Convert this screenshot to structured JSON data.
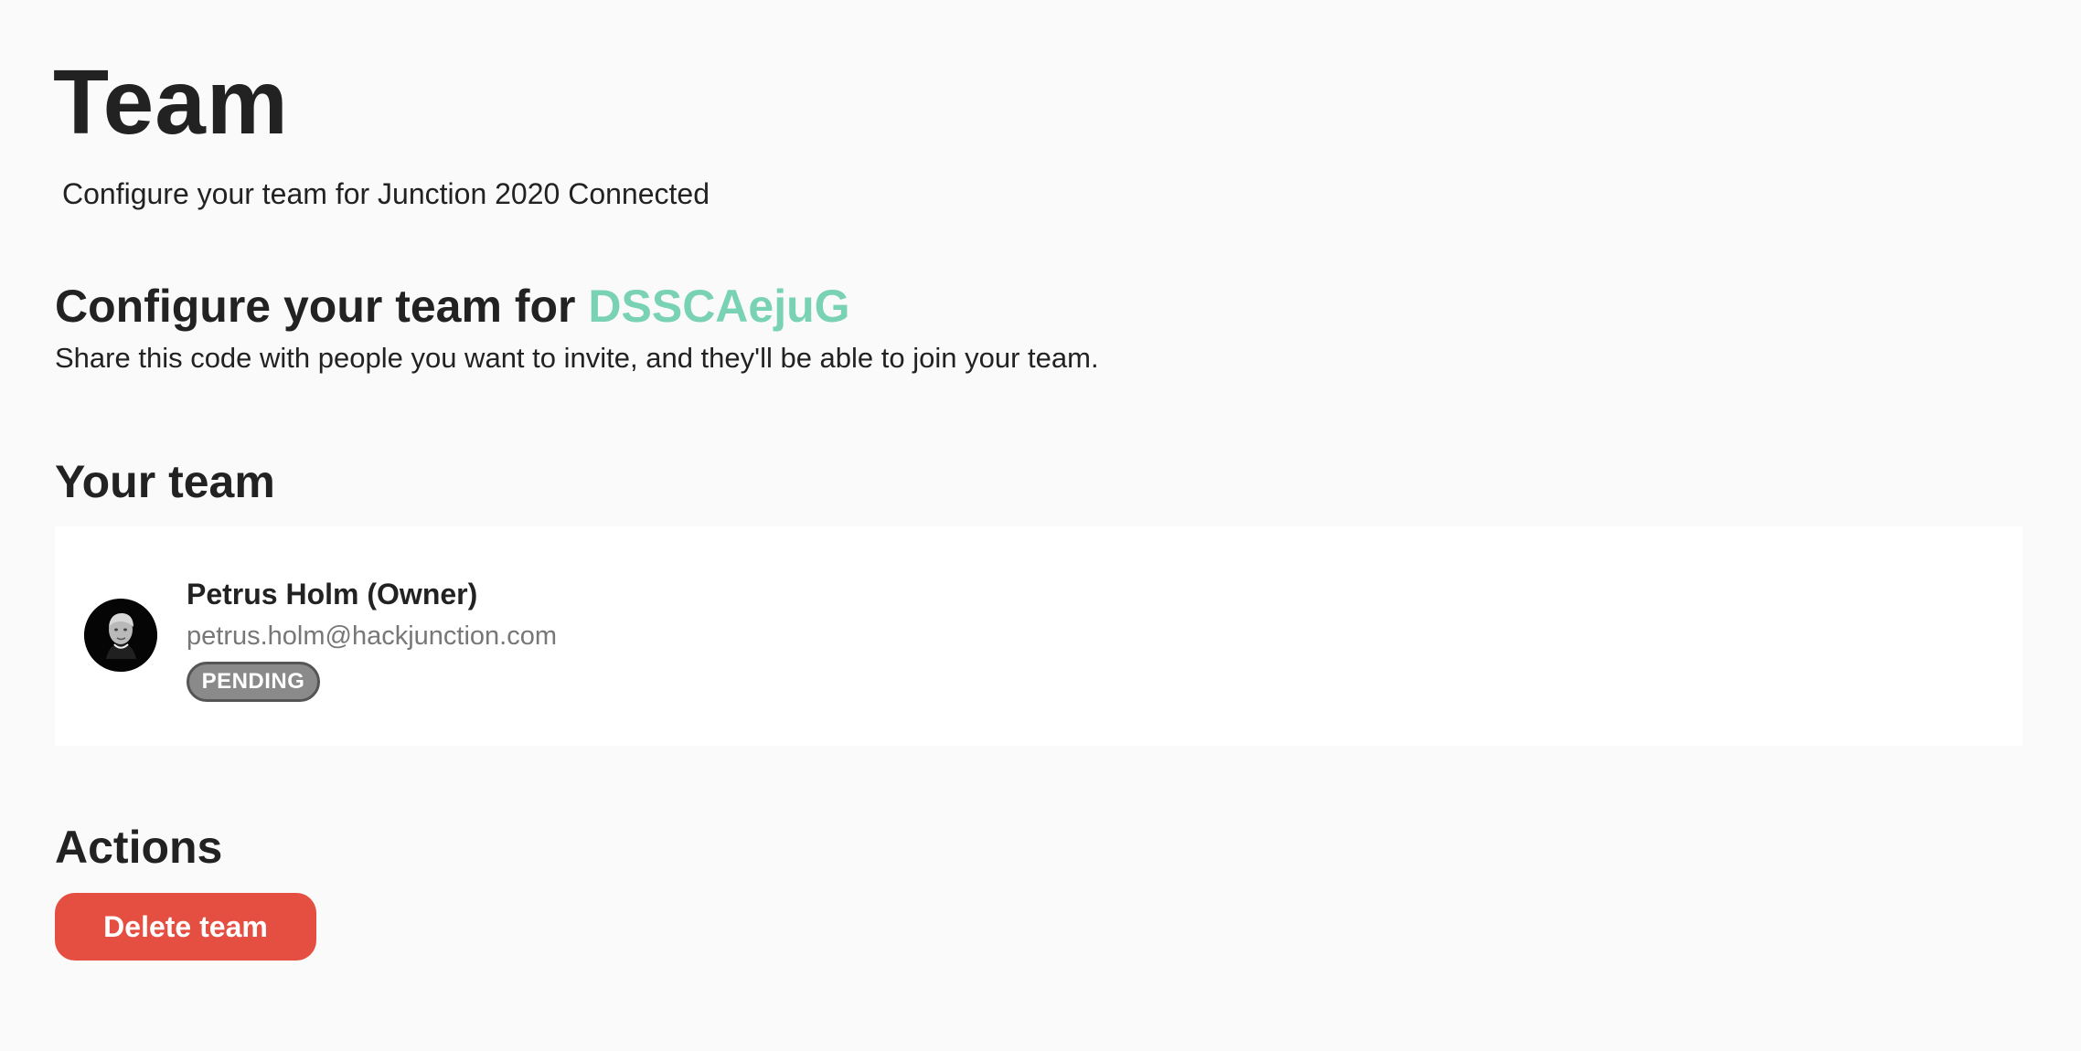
{
  "header": {
    "title": "Team",
    "subtitle": "Configure your team for Junction 2020 Connected"
  },
  "invite": {
    "title_prefix": "Configure your team for",
    "code": "DSSCAejuG",
    "help_text": "Share this code with people you want to invite, and they'll be able to join your team.",
    "code_color": "#7ad2b5"
  },
  "team": {
    "title": "Your team",
    "members": [
      {
        "name": "Petrus Holm (Owner)",
        "email": "petrus.holm@hackjunction.com",
        "status": "PENDING",
        "avatar": "profile-photo"
      }
    ]
  },
  "actions": {
    "title": "Actions",
    "delete_label": "Delete team",
    "delete_color": "#e54f42"
  }
}
